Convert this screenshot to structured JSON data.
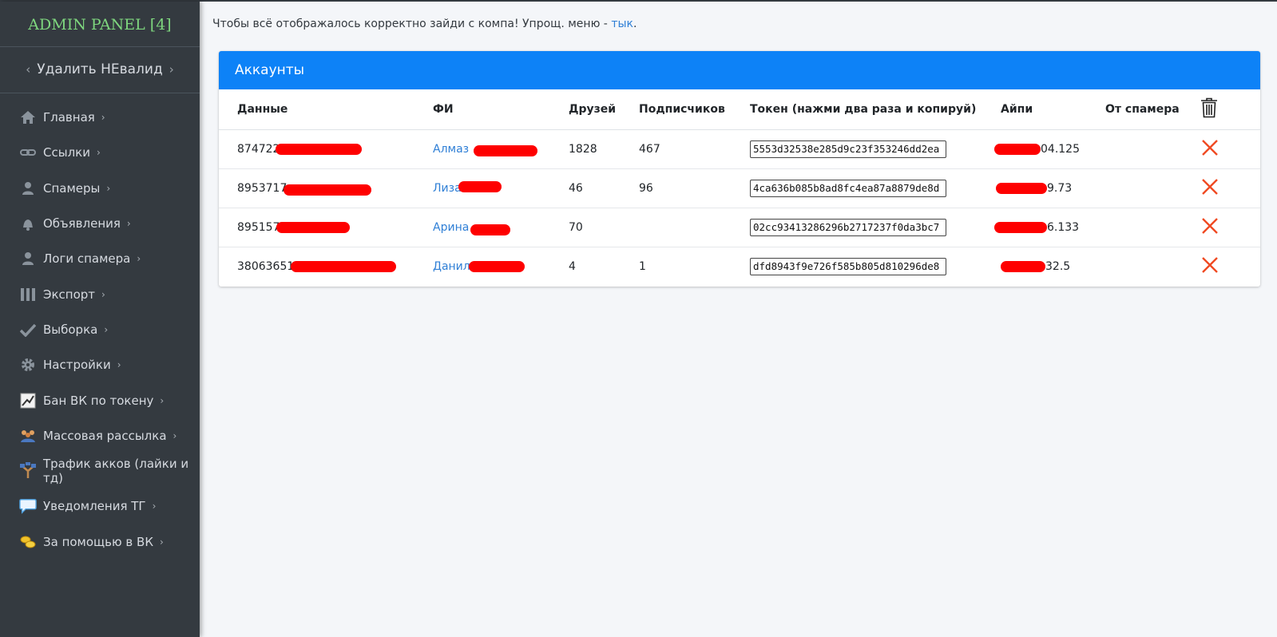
{
  "sidebar": {
    "brand": "ADMIN PANEL [4]",
    "delete_invalid": "Удалить НЕвалид",
    "items": [
      {
        "label": "Главная",
        "icon": "home-icon"
      },
      {
        "label": "Ссылки",
        "icon": "link-icon"
      },
      {
        "label": "Спамеры",
        "icon": "user-icon"
      },
      {
        "label": "Объявления",
        "icon": "bell-icon"
      },
      {
        "label": "Логи спамера",
        "icon": "user-icon"
      },
      {
        "label": "Экспорт",
        "icon": "list-icon"
      },
      {
        "label": "Выборка",
        "icon": "check-icon"
      },
      {
        "label": "Настройки",
        "icon": "gear-icon"
      },
      {
        "label": "Бан ВК по токену",
        "icon": "chart-icon"
      },
      {
        "label": "Массовая рассылка",
        "icon": "users-icon"
      },
      {
        "label": "Трафик акков (лайки и тд)",
        "icon": "network-icon"
      },
      {
        "label": "Уведомления ТГ",
        "icon": "chat-icon"
      },
      {
        "label": "За помощью в ВК",
        "icon": "coins-icon"
      }
    ]
  },
  "notice": {
    "text": "Чтобы всё отображалось корректно зайди с компа! Упрощ. меню - ",
    "link": "тык",
    "tail": "."
  },
  "card": {
    "title": "Аккаунты",
    "columns": [
      "Данные",
      "ФИ",
      "Друзей",
      "Подписчиков",
      "Токен (нажми два раза и копируй)",
      "Айпи",
      "От спамера"
    ],
    "rows": [
      {
        "data": "874722",
        "name": "Алмаз",
        "friends": "1828",
        "subs": "467",
        "token": "5553d32538e285d9c23f353246dd2ea",
        "ip": "04.125",
        "from": ""
      },
      {
        "data": "8953717",
        "name": "Лиза",
        "friends": "46",
        "subs": "96",
        "token": "4ca636b085b8ad8fc4ea87a8879de8d",
        "ip": "9.73",
        "from": ""
      },
      {
        "data": "895157",
        "name": "Арина",
        "friends": "70",
        "subs": "",
        "token": "02cc93413286296b2717237f0da3bc7",
        "ip": "6.133",
        "from": ""
      },
      {
        "data": "38063651",
        "name": "Данил",
        "friends": "4",
        "subs": "1",
        "token": "dfd8943f9e726f585b805d810296de8",
        "ip": "32.5",
        "from": ""
      }
    ]
  },
  "colors": {
    "accent": "#0d82f7",
    "sidebar": "#343a40",
    "brand": "#7ed67e",
    "delete": "#f04a23"
  }
}
